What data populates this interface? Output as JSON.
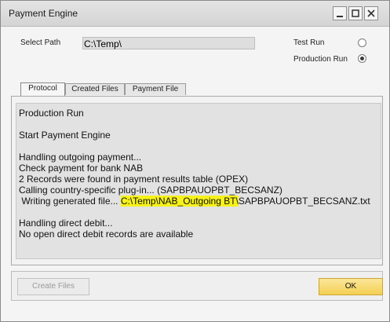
{
  "window": {
    "title": "Payment Engine",
    "controls": [
      "minimize",
      "maximize",
      "close"
    ]
  },
  "form": {
    "select_path_label": "Select Path",
    "select_path_value": "C:\\Temp\\",
    "test_run_label": "Test Run",
    "test_run_selected": false,
    "production_run_label": "Production Run",
    "production_run_selected": true
  },
  "tabs": [
    {
      "label": "Protocol",
      "active": true
    },
    {
      "label": "Created Files",
      "active": false
    },
    {
      "label": "Payment File",
      "active": false
    }
  ],
  "log": {
    "line_1": "Production Run",
    "line_2": "Start Payment Engine",
    "line_3": "Handling outgoing payment...",
    "line_4": "Check payment for bank NAB",
    "line_5": "2 Records were found in payment results table (OPEX)",
    "line_6": "Calling country-specific plug-in... (SAPBPAUOPBT_BECSANZ)",
    "line_7_prefix": " Writing generated file... ",
    "line_7_highlight": "C:\\Temp\\NAB_Outgoing BT\\",
    "line_7_suffix": "SAPBPAUOPBT_BECSANZ.txt",
    "line_8": "Handling direct debit...",
    "line_9": "No open direct debit records are available"
  },
  "buttons": {
    "create_files": "Create Files",
    "ok": "OK"
  },
  "colors": {
    "highlight": "#f6f21b",
    "ok_button": "#f4cf52"
  }
}
